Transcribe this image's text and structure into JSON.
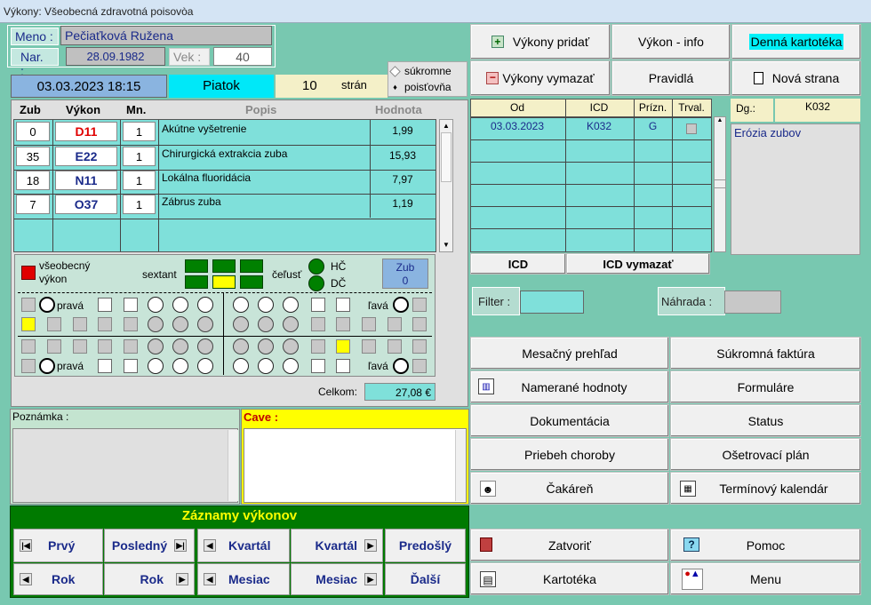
{
  "window": {
    "title": "Výkony: Všeobecná zdravotná poisovòa"
  },
  "patient": {
    "name_label": "Meno :",
    "name": "Pečiaťková Ružena",
    "dob_label": "Nar. :",
    "dob": "28.09.1982",
    "age_label": "Vek :",
    "age": "40"
  },
  "status": {
    "datetime": "03.03.2023 18:15",
    "day": "Piatok",
    "pages": "10",
    "pages_label": "strán"
  },
  "payer": {
    "private_label": "súkromne",
    "insurance_label": "poisťovňa"
  },
  "procedures": {
    "headers": {
      "tooth": "Zub",
      "code": "Výkon",
      "qty": "Mn.",
      "desc": "Popis",
      "value": "Hodnota"
    },
    "rows": [
      {
        "tooth": "0",
        "code": "D11",
        "qty": "1",
        "desc": "Akútne vyšetrenie",
        "value": "1,99"
      },
      {
        "tooth": "35",
        "code": "E22",
        "qty": "1",
        "desc": "Chirurgická extrakcia zuba",
        "value": "15,93"
      },
      {
        "tooth": "18",
        "code": "N11",
        "qty": "1",
        "desc": "Lokálna fluoridácia",
        "value": "7,97"
      },
      {
        "tooth": "7",
        "code": "O37",
        "qty": "1",
        "desc": "Zábrus zuba",
        "value": "1,19"
      }
    ]
  },
  "dental": {
    "general_label": "všeobecný výkon",
    "sextant_label": "sextant",
    "jaw_label": "čeľusť",
    "upper_label": "HČ",
    "lower_label": "DČ",
    "tooth_label": "Zub",
    "tooth_value": "0",
    "right_label": "pravá",
    "left_label": "ľavá"
  },
  "total": {
    "label": "Celkom:",
    "value": "27,08 €"
  },
  "note": {
    "label": "Poznámka :",
    "value": ""
  },
  "cave": {
    "label": "Cave :",
    "value": ""
  },
  "records": {
    "title": "Záznamy výkonov",
    "first": "Prvý",
    "last": "Posledný",
    "quarter_prev": "Kvartál",
    "quarter_next": "Kvartál",
    "previous": "Predošlý",
    "year_prev": "Rok",
    "year_next": "Rok",
    "month_prev": "Mesiac",
    "month_next": "Mesiac",
    "next": "Ďalší"
  },
  "top_buttons": {
    "add": "Výkony pridať",
    "info": "Výkon - info",
    "daily": "Denná kartotéka",
    "delete": "Výkony vymazať",
    "rules": "Pravidlá",
    "new_page": "Nová strana"
  },
  "icd": {
    "headers": {
      "from": "Od",
      "icd": "ICD",
      "flag": "Prízn.",
      "perm": "Trval."
    },
    "rows": [
      {
        "from": "03.03.2023",
        "icd": "K032",
        "flag": "G"
      }
    ],
    "dg_label": "Dg.:",
    "dg_code": "K032",
    "dg_text": "Erózia zubov",
    "icd_btn": "ICD",
    "icd_delete_btn": "ICD vymazať"
  },
  "filter": {
    "label": "Filter :",
    "value": "",
    "replace_label": "Náhrada :",
    "replace_value": ""
  },
  "menu": {
    "monthly": "Mesačný prehľad",
    "private_invoice": "Súkromná faktúra",
    "measured": "Namerané hodnoty",
    "forms": "Formuláre",
    "documentation": "Dokumentácia",
    "status": "Status",
    "disease_course": "Priebeh choroby",
    "treatment_plan": "Ošetrovací plán",
    "waiting_room": "Čakáreň",
    "calendar": "Termínový kalendár",
    "close": "Zatvoriť",
    "help": "Pomoc",
    "cardfile": "Kartotéka",
    "main_menu": "Menu"
  },
  "colors": {
    "background": "#78c8b0",
    "cyan": "#7fe0da",
    "blue_header": "#8ab4e0",
    "yellow": "#ffff00",
    "green_panel": "#007a00",
    "red_code": "#e00000",
    "navy_code": "#1a2a8a"
  }
}
